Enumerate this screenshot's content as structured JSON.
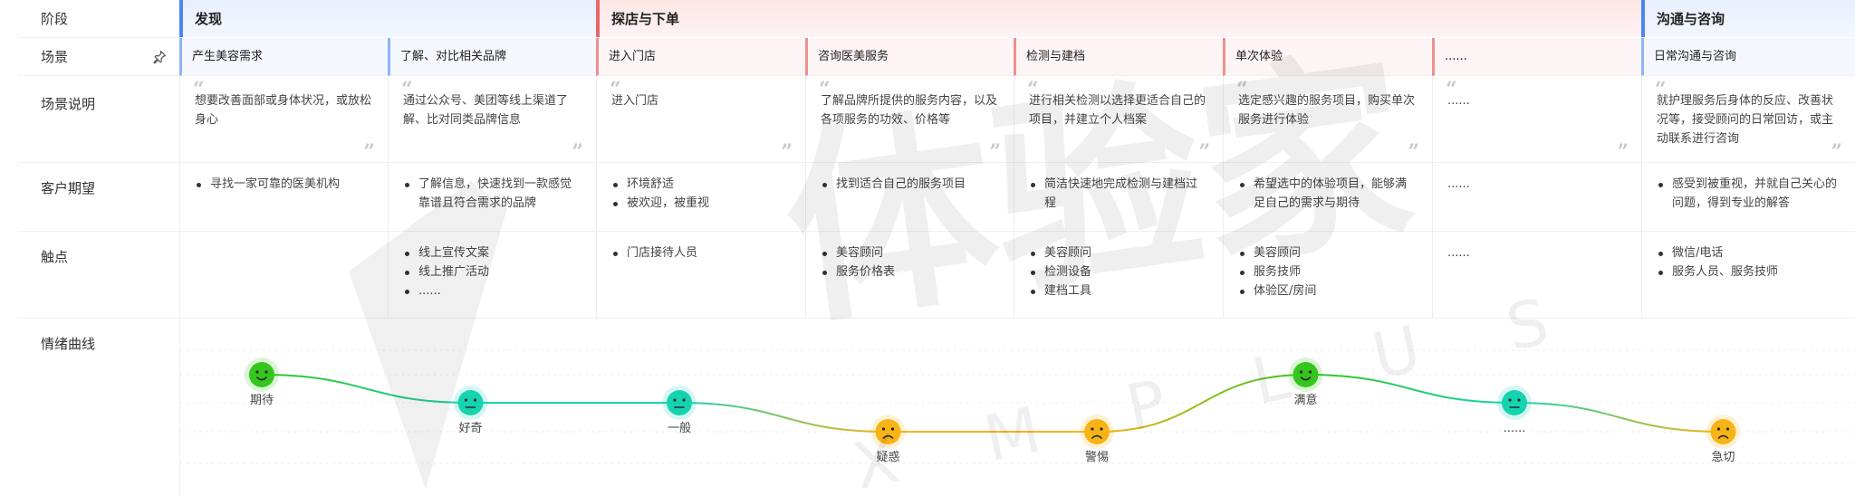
{
  "labels": {
    "stage": "阶段",
    "scene": "场景",
    "description": "场景说明",
    "expectation": "客户期望",
    "touchpoint": "触点",
    "emotion": "情绪曲线"
  },
  "stages": [
    {
      "name": "发现",
      "color": "#4a86f2"
    },
    {
      "name": "探店与下单",
      "color": "#e8686a"
    },
    {
      "name": "沟通与咨询",
      "color": "#4a86f2"
    }
  ],
  "scenes": [
    {
      "name": "产生美容需求",
      "stage": 0
    },
    {
      "name": "了解、对比相关品牌",
      "stage": 0
    },
    {
      "name": "进入门店",
      "stage": 1
    },
    {
      "name": "咨询医美服务",
      "stage": 1
    },
    {
      "name": "检测与建档",
      "stage": 1
    },
    {
      "name": "单次体验",
      "stage": 1
    },
    {
      "name": "......",
      "stage": 1
    },
    {
      "name": "日常沟通与咨询",
      "stage": 2
    }
  ],
  "descriptions": [
    "想要改善面部或身体状况，或放松身心",
    "通过公众号、美团等线上渠道了解、比对同类品牌信息",
    "进入门店",
    "了解品牌所提供的服务内容，以及各项服务的功效、价格等",
    "进行相关检测以选择更适合自己的项目，并建立个人档案",
    "选定感兴趣的服务项目，购买单次服务进行体验",
    "......",
    "就护理服务后身体的反应、改善状况等，接受顾问的日常回访，或主动联系进行咨询"
  ],
  "expectations": [
    [
      "寻找一家可靠的医美机构"
    ],
    [
      "了解信息，快速找到一款感觉靠谱且符合需求的品牌"
    ],
    [
      "环境舒适",
      "被欢迎，被重视"
    ],
    [
      "找到适合自己的服务项目"
    ],
    [
      "简洁快速地完成检测与建档过程"
    ],
    [
      "希望选中的体验项目，能够满足自己的需求与期待"
    ],
    "......",
    [
      "感受到被重视，并就自己关心的问题，得到专业的解答"
    ]
  ],
  "touchpoints": [
    [],
    [
      "线上宣传文案",
      "线上推广活动",
      "......"
    ],
    [
      "门店接待人员"
    ],
    [
      "美容顾问",
      "服务价格表"
    ],
    [
      "美容顾问",
      "检测设备",
      "建档工具"
    ],
    [
      "美容顾问",
      "服务技师",
      "体验区/房间"
    ],
    "......",
    [
      "微信/电话",
      "服务人员、服务技师"
    ]
  ],
  "emotions": [
    {
      "label": "期待",
      "level": 3,
      "mood": "happy",
      "color": "#35c61e"
    },
    {
      "label": "好奇",
      "level": 2,
      "mood": "neutral",
      "color": "#16d3b0"
    },
    {
      "label": "一般",
      "level": 2,
      "mood": "neutral",
      "color": "#16d3b0"
    },
    {
      "label": "疑惑",
      "level": 1,
      "mood": "sad",
      "color": "#f7b416"
    },
    {
      "label": "警惕",
      "level": 1,
      "mood": "sad",
      "color": "#f7b416"
    },
    {
      "label": "满意",
      "level": 3,
      "mood": "happy",
      "color": "#35c61e"
    },
    {
      "label": "......",
      "level": 2,
      "mood": "neutral",
      "color": "#16d3b0"
    },
    {
      "label": "急切",
      "level": 1,
      "mood": "sad",
      "color": "#f7b416"
    }
  ],
  "watermark": {
    "brand": "体验家",
    "sub": "XMPLUS"
  }
}
